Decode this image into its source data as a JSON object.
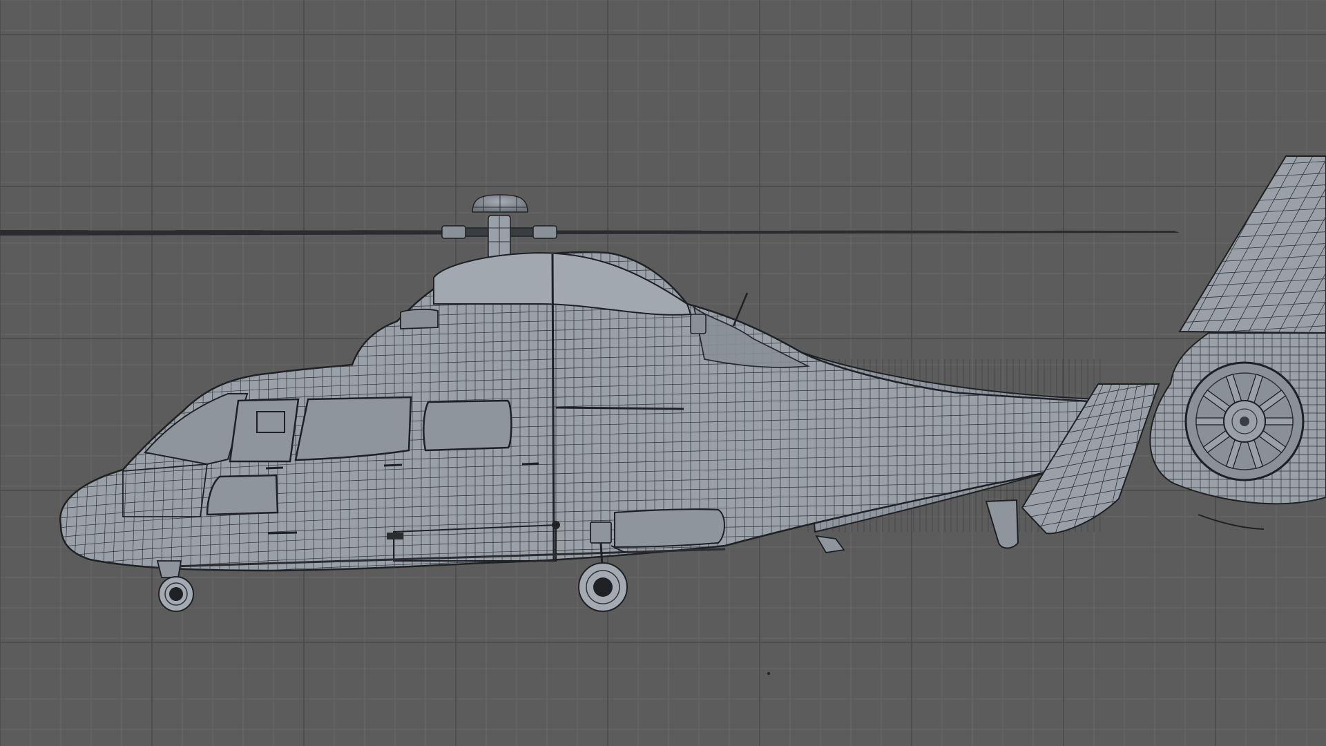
{
  "viewport": {
    "kind": "orthographic side view",
    "background_color": "#5c5c5c",
    "minor_grid_color": "#676767",
    "major_grid_color": "#4a4a4a",
    "grid": true
  },
  "model": {
    "subject": "helicopter",
    "shading": "wireframe-on-shaded",
    "body_color": "#9aa0a8",
    "body_shadow_color": "#7d838b",
    "wire_color": "#2f3338",
    "outline_color": "#1e2024",
    "window_color": "#8f959d",
    "rotor_color": "#2a2c30",
    "wheel_color": "#1f2124"
  }
}
